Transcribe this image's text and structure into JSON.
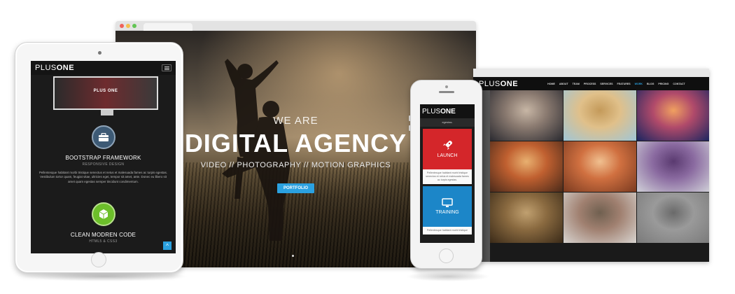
{
  "desktop": {
    "hero": {
      "kicker": "WE ARE",
      "title": "DIGITAL AGENCY",
      "tagline": "VIDEO // PHOTOGRAPHY // MOTION GRAPHICS",
      "button": "PORTFOLIO"
    }
  },
  "monitor": {
    "logo_light": "PLUS",
    "logo_bold": "ONE",
    "nav": [
      "HOME",
      "ABOUT",
      "TEAM",
      "PROCESS",
      "SERVICES",
      "FEATURES",
      "WORK",
      "BLOG",
      "PRICING",
      "CONTACT"
    ],
    "active_nav_index": 6,
    "tiles": [
      {
        "name": "woman-gown",
        "colors": [
          "#2a2a30",
          "#8a7a70",
          "#c7b6a5"
        ]
      },
      {
        "name": "starfish",
        "colors": [
          "#9fc6d8",
          "#e0c08a",
          "#c49a5a"
        ]
      },
      {
        "name": "lighthouse",
        "colors": [
          "#1a2560",
          "#b04a6a",
          "#f0a060"
        ]
      },
      {
        "name": "masquerade",
        "colors": [
          "#4a2a1a",
          "#c06030",
          "#e8b070"
        ]
      },
      {
        "name": "redhead",
        "colors": [
          "#7a3a20",
          "#d07040",
          "#f0c090"
        ]
      },
      {
        "name": "purple-knit",
        "colors": [
          "#d0d0d8",
          "#8a6aa0",
          "#5a3a70"
        ]
      },
      {
        "name": "lion",
        "colors": [
          "#3a2a18",
          "#8a6a40",
          "#c0a070"
        ]
      },
      {
        "name": "couple",
        "colors": [
          "#d8d4d0",
          "#a08070",
          "#706050"
        ]
      },
      {
        "name": "gray-tile",
        "colors": [
          "#7a7a7a",
          "#9a9a9a",
          "#6a6a6a"
        ]
      }
    ]
  },
  "tablet": {
    "logo_light": "PLUS",
    "logo_bold": "ONE",
    "mini_title": "PLUS ONE",
    "feature1": {
      "title": "BOOTSTRAP FRAMEWORK",
      "subtitle": "RESPONSIVE DESIGN",
      "text": "Pellentesque habitant morbi tristique senectus et netus et malesuada fames ac turpis egestas. Vestibulum tortor quam, feugiat vitae, ultricies eget, tempor sit amet, ante. Donec eu libero sit amet quam egestas semper tincidunt condimentum."
    },
    "feature2": {
      "title": "CLEAN MODREN CODE",
      "subtitle": "HTML5 & CSS3"
    },
    "scroll_top": "^"
  },
  "phone": {
    "logo_light": "PLUS",
    "logo_bold": "ONE",
    "strip_text": "egestas.",
    "card1": {
      "title": "LAUNCH",
      "text": "Pellentesque habitant morbi tristique senectus et netus et malesuada fames ac turpis egestas."
    },
    "card2": {
      "title": "TRAINING",
      "text": "Pellentesque habitant morbi tristique"
    }
  },
  "colors": {
    "accent": "#2ba1e0",
    "launch_red": "#d4262a",
    "training_blue": "#1c86c8",
    "feature_green": "#6cbf2a"
  }
}
